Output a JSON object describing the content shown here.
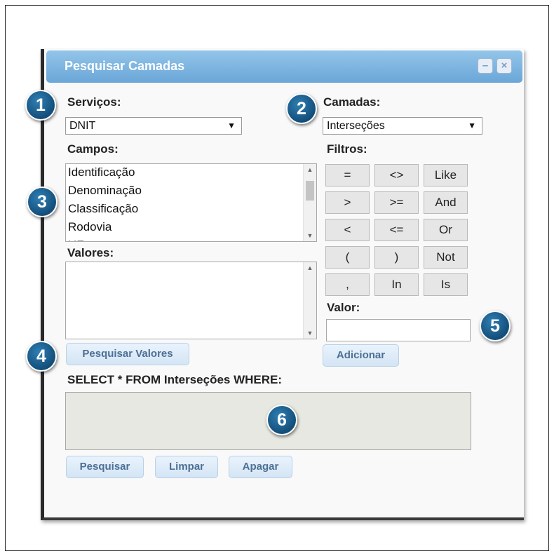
{
  "window": {
    "title": "Pesquisar Camadas",
    "minimize": "–",
    "close": "×"
  },
  "badges": [
    "1",
    "2",
    "3",
    "4",
    "5",
    "6"
  ],
  "servicos": {
    "label": "Serviços:",
    "value": "DNIT",
    "arrow": "▼"
  },
  "camadas": {
    "label": "Camadas:",
    "value": "Interseções",
    "arrow": "▼"
  },
  "campos": {
    "label": "Campos:",
    "items": [
      "Identificação",
      "Denominação",
      "Classificação",
      "Rodovia",
      "UF"
    ]
  },
  "filtros": {
    "label": "Filtros:",
    "buttons": [
      "=",
      "<>",
      "Like",
      ">",
      ">=",
      "And",
      "<",
      "<=",
      "Or",
      "(",
      ")",
      "Not",
      ",",
      "In",
      "Is"
    ]
  },
  "valores": {
    "label": "Valores:",
    "button": "Pesquisar Valores"
  },
  "valor": {
    "label": "Valor:",
    "value": "",
    "button": "Adicionar"
  },
  "query": {
    "label": "SELECT * FROM Interseções WHERE:",
    "text": ""
  },
  "actions": {
    "pesquisar": "Pesquisar",
    "limpar": "Limpar",
    "apagar": "Apagar"
  },
  "colors": {
    "title_bar": "#7db4e0",
    "badge": "#1d5e8f",
    "button_text": "#4d6f94"
  }
}
